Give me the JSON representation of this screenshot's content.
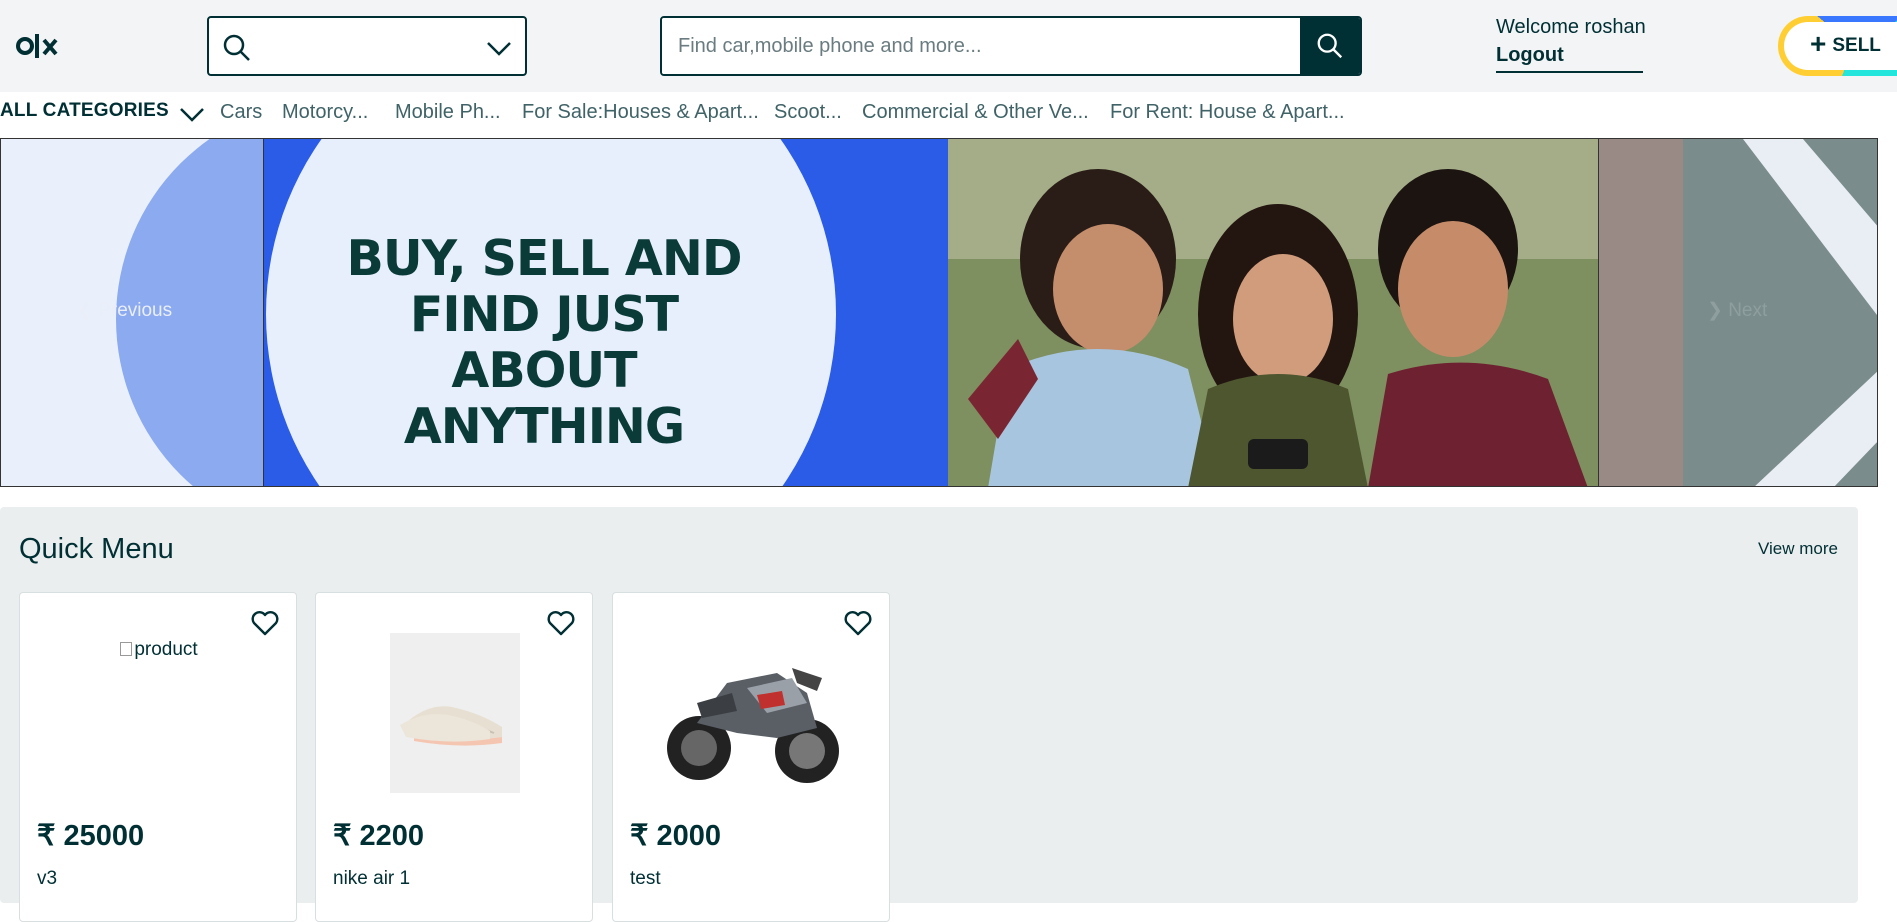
{
  "header": {
    "logo_text": "olx",
    "location": {
      "value": ""
    },
    "search": {
      "placeholder": "Find car,mobile phone and more..."
    },
    "welcome": "Welcome roshan",
    "logout": "Logout",
    "sell": {
      "plus": "+",
      "label": "SELL"
    }
  },
  "categories": {
    "all_label": "ALL CATEGORIES",
    "items": [
      "Cars",
      "Motorcy...",
      "Mobile Ph...",
      "For Sale:Houses & Apart...",
      "Scoot...",
      "Commercial & Other Ve...",
      "For Rent: House & Apart..."
    ]
  },
  "banner": {
    "tagline": [
      "BUY, SELL AND",
      "FIND JUST ABOUT",
      "ANYTHING"
    ],
    "prev_label": "Previous",
    "next_label": "Next"
  },
  "quick_menu": {
    "title": "Quick Menu",
    "view_more": "View more",
    "products": [
      {
        "price": "₹ 25000",
        "name": "v3",
        "image_alt": "product",
        "image_kind": "broken"
      },
      {
        "price": "₹ 2200",
        "name": "nike air 1",
        "image_alt": "",
        "image_kind": "sneaker"
      },
      {
        "price": "₹ 2000",
        "name": "test",
        "image_alt": "",
        "image_kind": "motorcycle"
      }
    ]
  },
  "colors": {
    "brand_dark": "#002f34",
    "banner_blue": "#2a5ce8",
    "quick_bg": "#ebeeef",
    "sell_yellow": "#ffce32",
    "sell_blue": "#3a77ff",
    "sell_teal": "#23e5db"
  }
}
